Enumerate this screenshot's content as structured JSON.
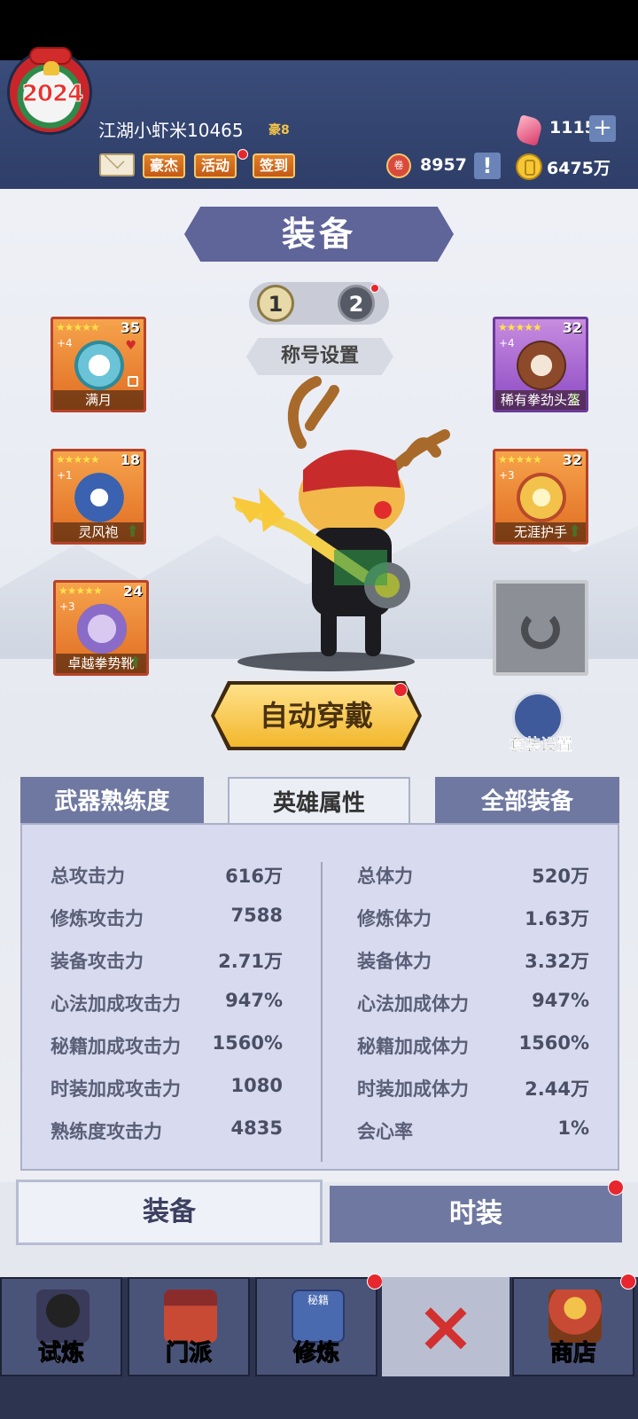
{
  "header": {
    "avatar_year": "2024",
    "username": "江湖小虾米10465",
    "vip": "豪8",
    "buttons": [
      {
        "label": "豪杰"
      },
      {
        "label": "活动"
      },
      {
        "label": "签到"
      }
    ],
    "gems": "1115",
    "tokens": "8957",
    "token_icon_label": "卷",
    "coins": "6475万",
    "plus_label": "+",
    "alert_label": "!"
  },
  "page_title": "装备",
  "page_switch": {
    "page1": "1",
    "page2": "2",
    "selected": "1"
  },
  "title_setting": "称号设置",
  "equipment": [
    {
      "name": "满月",
      "level": "35",
      "plus": "+4",
      "stars": "★★★★★"
    },
    {
      "name": "灵风袍",
      "level": "18",
      "plus": "+1",
      "stars": "★★★★★"
    },
    {
      "name": "卓越拳势靴",
      "level": "24",
      "plus": "+3",
      "stars": "★★★★★"
    },
    {
      "name": "稀有拳劲头盔",
      "level": "32",
      "plus": "+4",
      "stars": "★★★★★"
    },
    {
      "name": "无涯护手",
      "level": "32",
      "plus": "+3",
      "stars": "★★★★★"
    }
  ],
  "auto_equip": "自动穿戴",
  "suit_setting": "套装设置",
  "tabs": [
    {
      "label": "武器熟练度"
    },
    {
      "label": "英雄属性"
    },
    {
      "label": "全部装备"
    }
  ],
  "stats_left": [
    {
      "label": "总攻击力",
      "value": "616万"
    },
    {
      "label": "修炼攻击力",
      "value": "7588"
    },
    {
      "label": "装备攻击力",
      "value": "2.71万"
    },
    {
      "label": "心法加成攻击力",
      "value": "947%"
    },
    {
      "label": "秘籍加成攻击力",
      "value": "1560%"
    },
    {
      "label": "时装加成攻击力",
      "value": "1080"
    },
    {
      "label": "熟练度攻击力",
      "value": "4835"
    }
  ],
  "stats_right": [
    {
      "label": "总体力",
      "value": "520万"
    },
    {
      "label": "修炼体力",
      "value": "1.63万"
    },
    {
      "label": "装备体力",
      "value": "3.32万"
    },
    {
      "label": "心法加成体力",
      "value": "947%"
    },
    {
      "label": "秘籍加成体力",
      "value": "1560%"
    },
    {
      "label": "时装加成体力",
      "value": "2.44万"
    },
    {
      "label": "会心率",
      "value": "1%"
    }
  ],
  "bottom_tabs": {
    "equip": "装备",
    "fashion": "时装"
  },
  "nav": [
    {
      "label": "试炼"
    },
    {
      "label": "门派"
    },
    {
      "label": "修炼"
    },
    {
      "label": "×"
    },
    {
      "label": "商店"
    }
  ],
  "nav_book_label": "秘籍",
  "colors": {
    "accent": "#5f6499",
    "gold_button": "#f2b72c",
    "tab_inactive": "#6f78a0",
    "red_dot": "#e7262e"
  }
}
